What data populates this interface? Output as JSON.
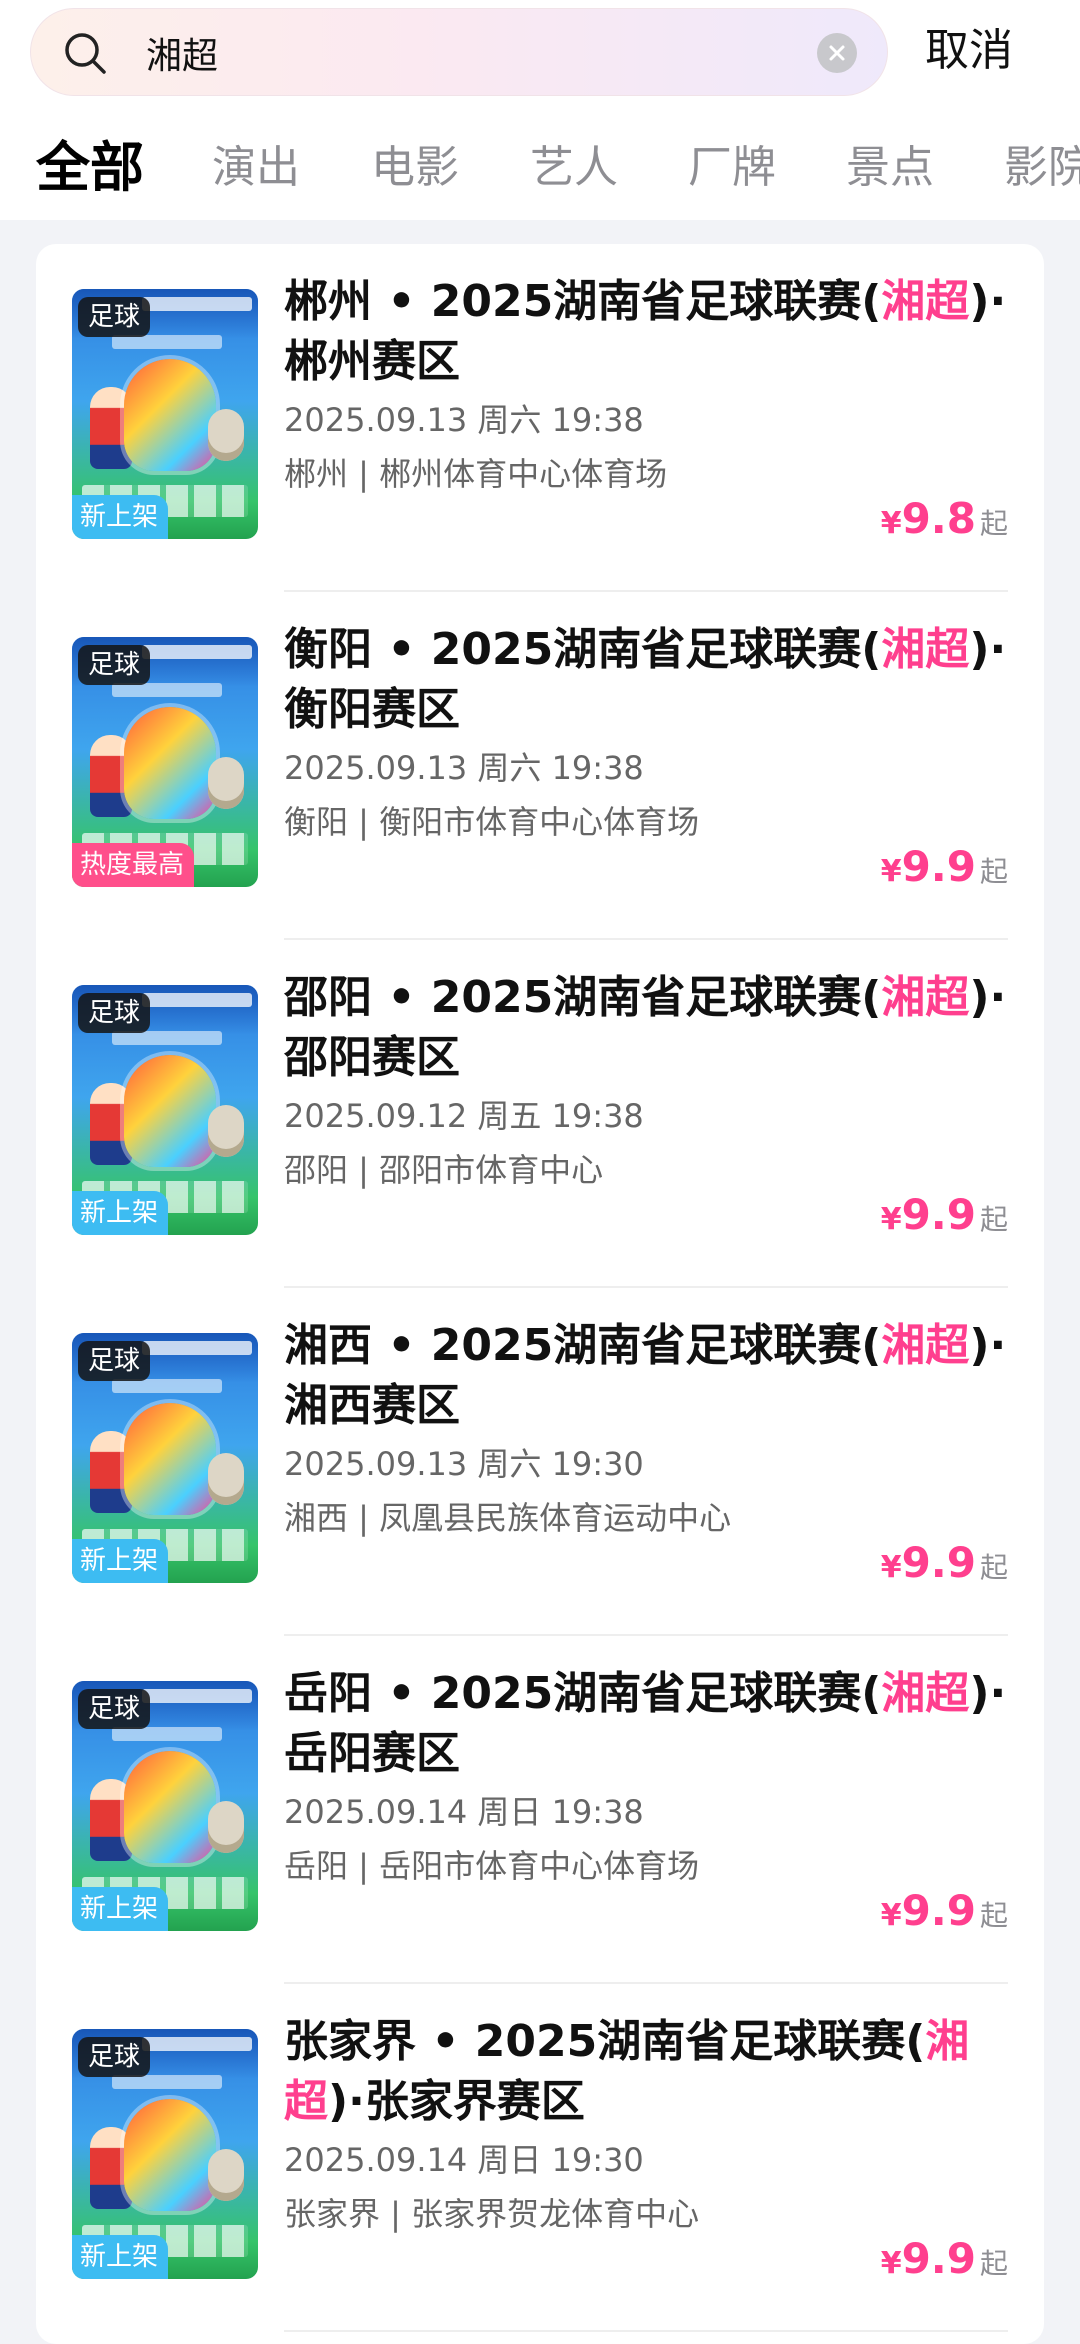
{
  "search": {
    "value": "湘超",
    "placeholder": ""
  },
  "cancel_label": "取消",
  "tabs": [
    "全部",
    "演出",
    "电影",
    "艺人",
    "厂牌",
    "景点",
    "影院"
  ],
  "colors": {
    "accent": "#ff3f8e",
    "new_badge": "#3dbcf2",
    "hot_badge": "#ff4f8b"
  },
  "results": [
    {
      "city": "郴州",
      "title_main": " • 2025湖南省足球联赛(",
      "title_hl": "湘超",
      "title_tail": ")·郴州赛区",
      "time": "2025.09.13 周六 19:38",
      "venue": "郴州 | 郴州体育中心体育场",
      "price_symbol": "¥",
      "price": "9.8",
      "price_suffix": "起",
      "category": "足球",
      "badge": "新上架"
    },
    {
      "city": "衡阳",
      "title_main": " • 2025湖南省足球联赛(",
      "title_hl": "湘超",
      "title_tail": ")·衡阳赛区",
      "time": "2025.09.13 周六 19:38",
      "venue": "衡阳 | 衡阳市体育中心体育场",
      "price_symbol": "¥",
      "price": "9.9",
      "price_suffix": "起",
      "category": "足球",
      "badge": "热度最高"
    },
    {
      "city": "邵阳",
      "title_main": " • 2025湖南省足球联赛(",
      "title_hl": "湘超",
      "title_tail": ")·邵阳赛区",
      "time": "2025.09.12 周五 19:38",
      "venue": "邵阳 | 邵阳市体育中心",
      "price_symbol": "¥",
      "price": "9.9",
      "price_suffix": "起",
      "category": "足球",
      "badge": "新上架"
    },
    {
      "city": "湘西",
      "title_main": " • 2025湖南省足球联赛(",
      "title_hl": "湘超",
      "title_tail": ")·湘西赛区",
      "time": "2025.09.13 周六 19:30",
      "venue": "湘西 | 凤凰县民族体育运动中心",
      "price_symbol": "¥",
      "price": "9.9",
      "price_suffix": "起",
      "category": "足球",
      "badge": "新上架"
    },
    {
      "city": "岳阳",
      "title_main": " • 2025湖南省足球联赛(",
      "title_hl": "湘超",
      "title_tail": ")·岳阳赛区",
      "time": "2025.09.14 周日 19:38",
      "venue": "岳阳 | 岳阳市体育中心体育场",
      "price_symbol": "¥",
      "price": "9.9",
      "price_suffix": "起",
      "category": "足球",
      "badge": "新上架"
    },
    {
      "city": "张家界",
      "title_main": " • 2025湖南省足球联赛(",
      "title_hl": "湘超",
      "title_tail": ")·张家界赛区",
      "time": "2025.09.14 周日 19:30",
      "venue": "张家界 | 张家界贺龙体育中心",
      "price_symbol": "¥",
      "price": "9.9",
      "price_suffix": "起",
      "category": "足球",
      "badge": "新上架"
    }
  ]
}
